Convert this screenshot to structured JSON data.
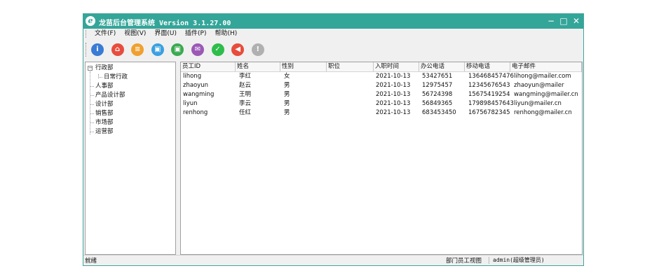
{
  "window": {
    "title": "龙苗后台管理系统 Version 3.1.27.00",
    "app_icon": "e",
    "buttons": [
      {
        "name": "minimize",
        "glyph": "−"
      },
      {
        "name": "maximize",
        "glyph": "□"
      },
      {
        "name": "close",
        "glyph": "✕"
      }
    ]
  },
  "menu": [
    "文件(F)",
    "视图(V)",
    "界面(U)",
    "插件(P)",
    "帮助(H)"
  ],
  "toolbar": [
    {
      "icon": "user-info-icon",
      "glyph": "i",
      "color": "#3a7bd5"
    },
    {
      "icon": "home-icon",
      "glyph": "⌂",
      "color": "#e84c3d"
    },
    {
      "icon": "document-icon",
      "glyph": "≡",
      "color": "#f0a030"
    },
    {
      "icon": "contact-card-icon",
      "glyph": "▣",
      "color": "#3aa0e0"
    },
    {
      "icon": "person-icon",
      "glyph": "▣",
      "color": "#3aaa50"
    },
    {
      "icon": "mail-icon",
      "glyph": "✉",
      "color": "#9b59b6"
    },
    {
      "icon": "shield-check-icon",
      "glyph": "✓",
      "color": "#2ebd4b"
    },
    {
      "icon": "volume-icon",
      "glyph": "◀",
      "color": "#e74c3c"
    },
    {
      "icon": "alert-icon",
      "glyph": "!",
      "color": "#b0b0b0"
    }
  ],
  "tree": [
    {
      "label": "行政部",
      "level": 0,
      "expander": "−"
    },
    {
      "label": "日常行政",
      "level": 1
    },
    {
      "label": "人事部",
      "level": 0
    },
    {
      "label": "产品设计部",
      "level": 0
    },
    {
      "label": "设计部",
      "level": 0
    },
    {
      "label": "销售部",
      "level": 0
    },
    {
      "label": "市场部",
      "level": 0
    },
    {
      "label": "运营部",
      "level": 0
    }
  ],
  "table": {
    "columns": [
      "员工ID",
      "姓名",
      "性别",
      "职位",
      "入职时间",
      "办公电话",
      "移动电话",
      "电子邮件"
    ],
    "rows": [
      [
        "lihong",
        "李红",
        "女",
        "",
        "2021-10-13",
        "53427651",
        "136468457476",
        "lihong@mailer.com"
      ],
      [
        "zhaoyun",
        "赵云",
        "男",
        "",
        "2021-10-13",
        "12975457",
        "12345676543",
        "zhaoyun@mailer"
      ],
      [
        "wangming",
        "王明",
        "男",
        "",
        "2021-10-13",
        "56724398",
        "15675419254",
        "wangming@mailer.cn"
      ],
      [
        "liyun",
        "李云",
        "男",
        "",
        "2021-10-13",
        "56849365",
        "179898457643",
        "liyun@mailer.cn"
      ],
      [
        "renhong",
        "任红",
        "男",
        "",
        "2021-10-13",
        "683453450",
        "16756782345",
        "renhong@mailer.cn"
      ]
    ]
  },
  "status": {
    "left": "就绪",
    "view": "部门员工视图",
    "user": "admin(超级管理员)"
  }
}
